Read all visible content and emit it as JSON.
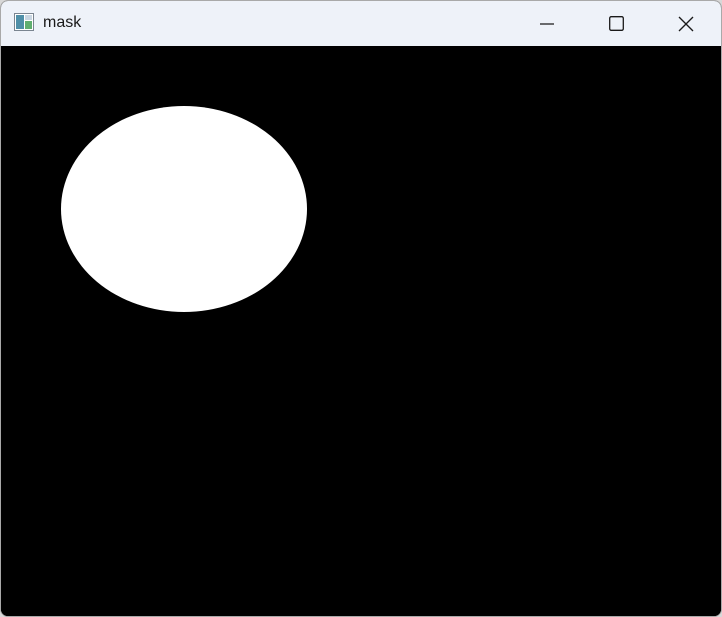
{
  "window": {
    "title": "mask",
    "icon": "app-window-icon",
    "controls": {
      "minimize_icon": "minimize-icon",
      "maximize_icon": "maximize-icon",
      "close_icon": "close-icon"
    }
  },
  "canvas": {
    "background": "#000000",
    "mask_shape": "ellipse",
    "mask_color": "#ffffff"
  }
}
